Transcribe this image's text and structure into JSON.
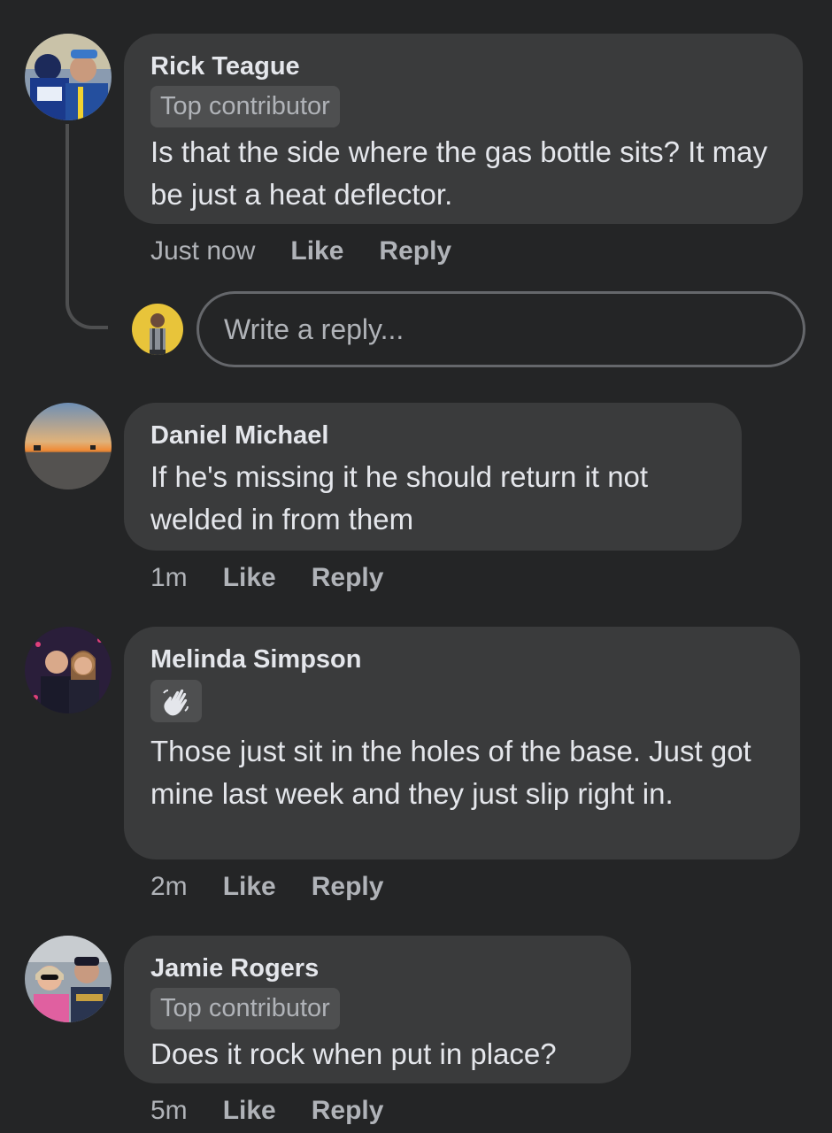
{
  "comments": [
    {
      "name": "Rick Teague",
      "badge": "Top contributor",
      "text": "Is that the side where the gas bottle sits? It may be just a heat deflector.",
      "time": "Just now",
      "like": "Like",
      "reply": "Reply"
    },
    {
      "name": "Daniel Michael",
      "text": "If he's missing it he should return it not welded in from them",
      "time": "1m",
      "like": "Like",
      "reply": "Reply"
    },
    {
      "name": "Melinda Simpson",
      "badge_icon": "waving-hand-icon",
      "text": "Those just sit in the holes of the base. Just got mine last week and they just slip right in.",
      "time": "2m",
      "like": "Like",
      "reply": "Reply"
    },
    {
      "name": "Jamie Rogers",
      "badge": "Top contributor",
      "text": "Does it rock when put in place?",
      "time": "5m",
      "like": "Like",
      "reply": "Reply"
    }
  ],
  "reply_box": {
    "placeholder": "Write a reply..."
  },
  "colors": {
    "background": "#242526",
    "bubble": "#3a3b3c",
    "badge": "#4e4f50",
    "primary_text": "#e4e6eb",
    "secondary_text": "#b0b3b8"
  }
}
